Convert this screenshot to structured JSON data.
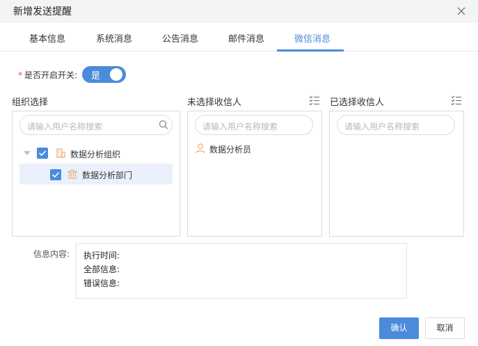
{
  "dialog": {
    "title": "新增发送提醒"
  },
  "tabs": [
    {
      "label": "基本信息",
      "active": false
    },
    {
      "label": "系统消息",
      "active": false
    },
    {
      "label": "公告消息",
      "active": false
    },
    {
      "label": "邮件消息",
      "active": false
    },
    {
      "label": "微信消息",
      "active": true
    }
  ],
  "enable": {
    "required_mark": "*",
    "label": "是否开启开关:",
    "switch_text": "是",
    "on": true
  },
  "org": {
    "label": "组织选择",
    "search_placeholder": "请输入用户名称搜索",
    "tree": [
      {
        "label": "数据分析组织",
        "icon": "org-building-icon",
        "checked": true,
        "expanded": true
      },
      {
        "label": "数据分析部门",
        "icon": "department-bank-icon",
        "checked": true,
        "selected": true
      }
    ]
  },
  "unselected": {
    "label": "未选择收信人",
    "search_placeholder": "请输入用户名称搜索",
    "items": [
      {
        "label": "数据分析员",
        "icon": "user-icon"
      }
    ]
  },
  "selected": {
    "label": "已选择收信人",
    "search_placeholder": "请输入用户名称搜索",
    "items": []
  },
  "message": {
    "label": "信息内容:",
    "lines": [
      "执行时间:",
      "全部信息:",
      "错误信息:"
    ]
  },
  "buttons": {
    "confirm": "确认",
    "cancel": "取消"
  },
  "colors": {
    "primary": "#4a8bdc",
    "icon_orange": "#f0a766",
    "required": "#e5484d"
  }
}
